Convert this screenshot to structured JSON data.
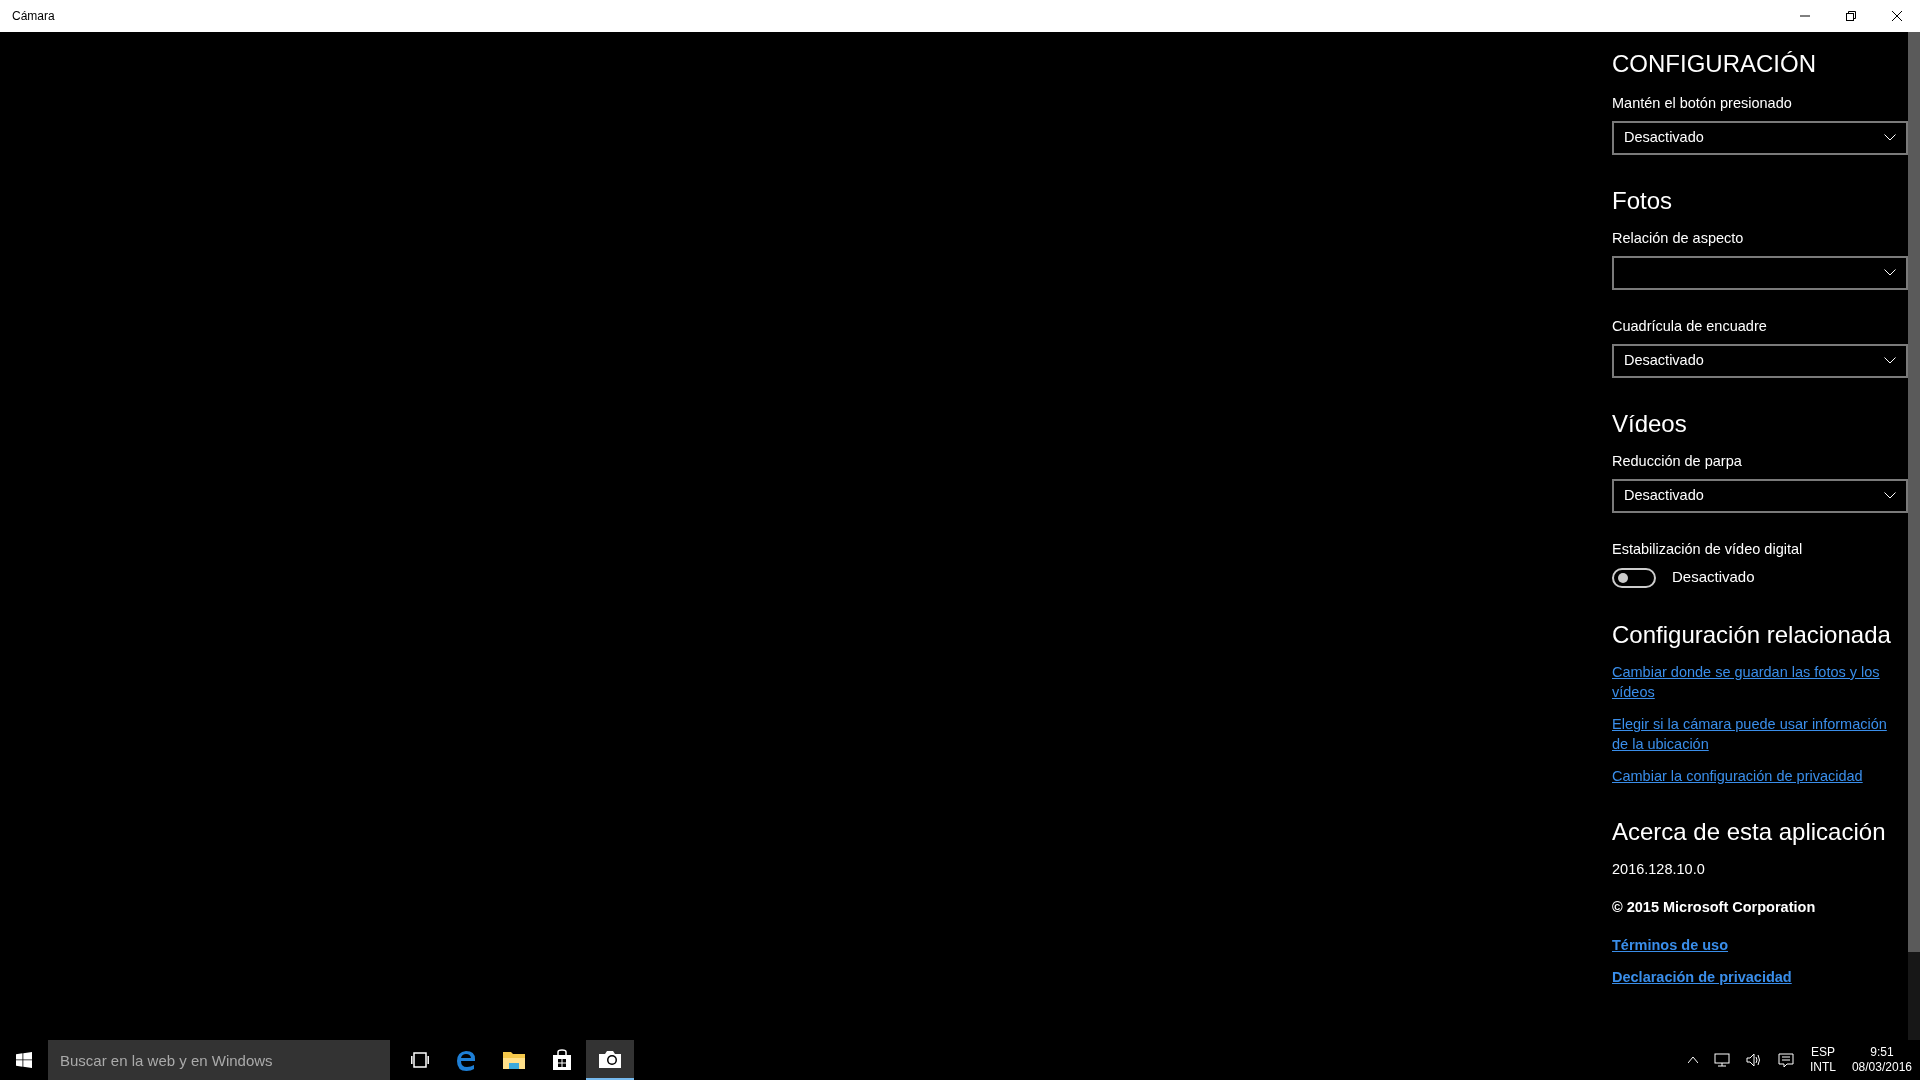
{
  "window": {
    "title": "Cámara"
  },
  "settings": [
    {
      "kind": "title",
      "text": "CONFIGURACIÓN"
    },
    {
      "kind": "dropdown",
      "label": "Mantén el botón presionado",
      "value": "Desactivado"
    },
    {
      "kind": "heading",
      "text": "Fotos"
    },
    {
      "kind": "dropdown",
      "label": "Relación de aspecto"
    },
    {
      "kind": "dropdown",
      "label": "Cuadrícula de encuadre",
      "value": "Desactivado"
    },
    {
      "kind": "heading",
      "text": "Vídeos"
    },
    {
      "kind": "dropdown",
      "label": "Reducción de parpa",
      "value": "Desactivado"
    },
    {
      "kind": "toggle",
      "label": "Estabilización de vídeo digital",
      "on": false,
      "state_text": "Desactivado"
    },
    {
      "kind": "heading",
      "text": "Configuración relacionada"
    },
    {
      "kind": "link",
      "text": "Cambiar donde se guardan las fotos y los vídeos",
      "bold": false
    },
    {
      "kind": "link",
      "text": "Elegir si la cámara puede usar información de la ubicación",
      "bold": false
    },
    {
      "kind": "link",
      "text": "Cambiar la configuración de privacidad",
      "bold": false
    },
    {
      "kind": "heading",
      "text": "Acerca de esta aplicación"
    },
    {
      "kind": "text",
      "text": "2016.128.10.0",
      "bold": false
    },
    {
      "kind": "text",
      "text": "© 2015 Microsoft Corporation",
      "bold": true
    },
    {
      "kind": "link",
      "text": "Términos de uso",
      "bold": true
    },
    {
      "kind": "link",
      "text": "Declaración de privacidad",
      "bold": true
    }
  ],
  "taskbar": {
    "search": {
      "placeholder": "Buscar en la web y en Windows"
    },
    "apps": [
      {
        "kind": "taskview",
        "selected": false
      },
      {
        "kind": "edge",
        "selected": false
      },
      {
        "kind": "folder",
        "selected": false
      },
      {
        "kind": "store",
        "selected": false
      },
      {
        "kind": "camera",
        "selected": true
      }
    ],
    "language": [
      "ESP",
      "INTL"
    ],
    "time": "9:51",
    "date": "08/03/2016"
  }
}
